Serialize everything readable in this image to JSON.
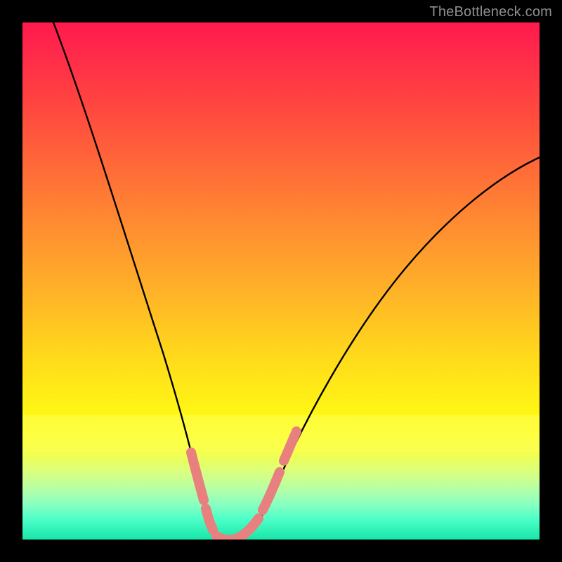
{
  "watermark": "TheBottleneck.com",
  "chart_data": {
    "type": "line",
    "title": "",
    "xlabel": "",
    "ylabel": "",
    "xlim": [
      0,
      100
    ],
    "ylim": [
      0,
      100
    ],
    "grid": false,
    "curve_approx": [
      {
        "x": 6,
        "y": 100
      },
      {
        "x": 10,
        "y": 88
      },
      {
        "x": 14,
        "y": 75
      },
      {
        "x": 18,
        "y": 62
      },
      {
        "x": 22,
        "y": 48
      },
      {
        "x": 26,
        "y": 35
      },
      {
        "x": 30,
        "y": 22
      },
      {
        "x": 32,
        "y": 14
      },
      {
        "x": 34,
        "y": 6
      },
      {
        "x": 36,
        "y": 1
      },
      {
        "x": 40,
        "y": 0
      },
      {
        "x": 44,
        "y": 2
      },
      {
        "x": 48,
        "y": 9
      },
      {
        "x": 56,
        "y": 24
      },
      {
        "x": 64,
        "y": 37
      },
      {
        "x": 72,
        "y": 47
      },
      {
        "x": 80,
        "y": 55
      },
      {
        "x": 88,
        "y": 62
      },
      {
        "x": 96,
        "y": 67
      },
      {
        "x": 100,
        "y": 69
      }
    ],
    "highlight_segments_approx": [
      {
        "x0": 32,
        "x1": 34.5,
        "side": "left"
      },
      {
        "x0": 35.5,
        "x1": 44,
        "side": "bottom"
      },
      {
        "x0": 44.5,
        "x1": 48,
        "side": "right"
      }
    ],
    "gradient_stops": [
      {
        "pos": 0.0,
        "color": "#ff1a4d"
      },
      {
        "pos": 0.3,
        "color": "#ff7a34"
      },
      {
        "pos": 0.6,
        "color": "#ffd21e"
      },
      {
        "pos": 0.8,
        "color": "#fdff2a"
      },
      {
        "pos": 1.0,
        "color": "#18e6a8"
      }
    ]
  }
}
